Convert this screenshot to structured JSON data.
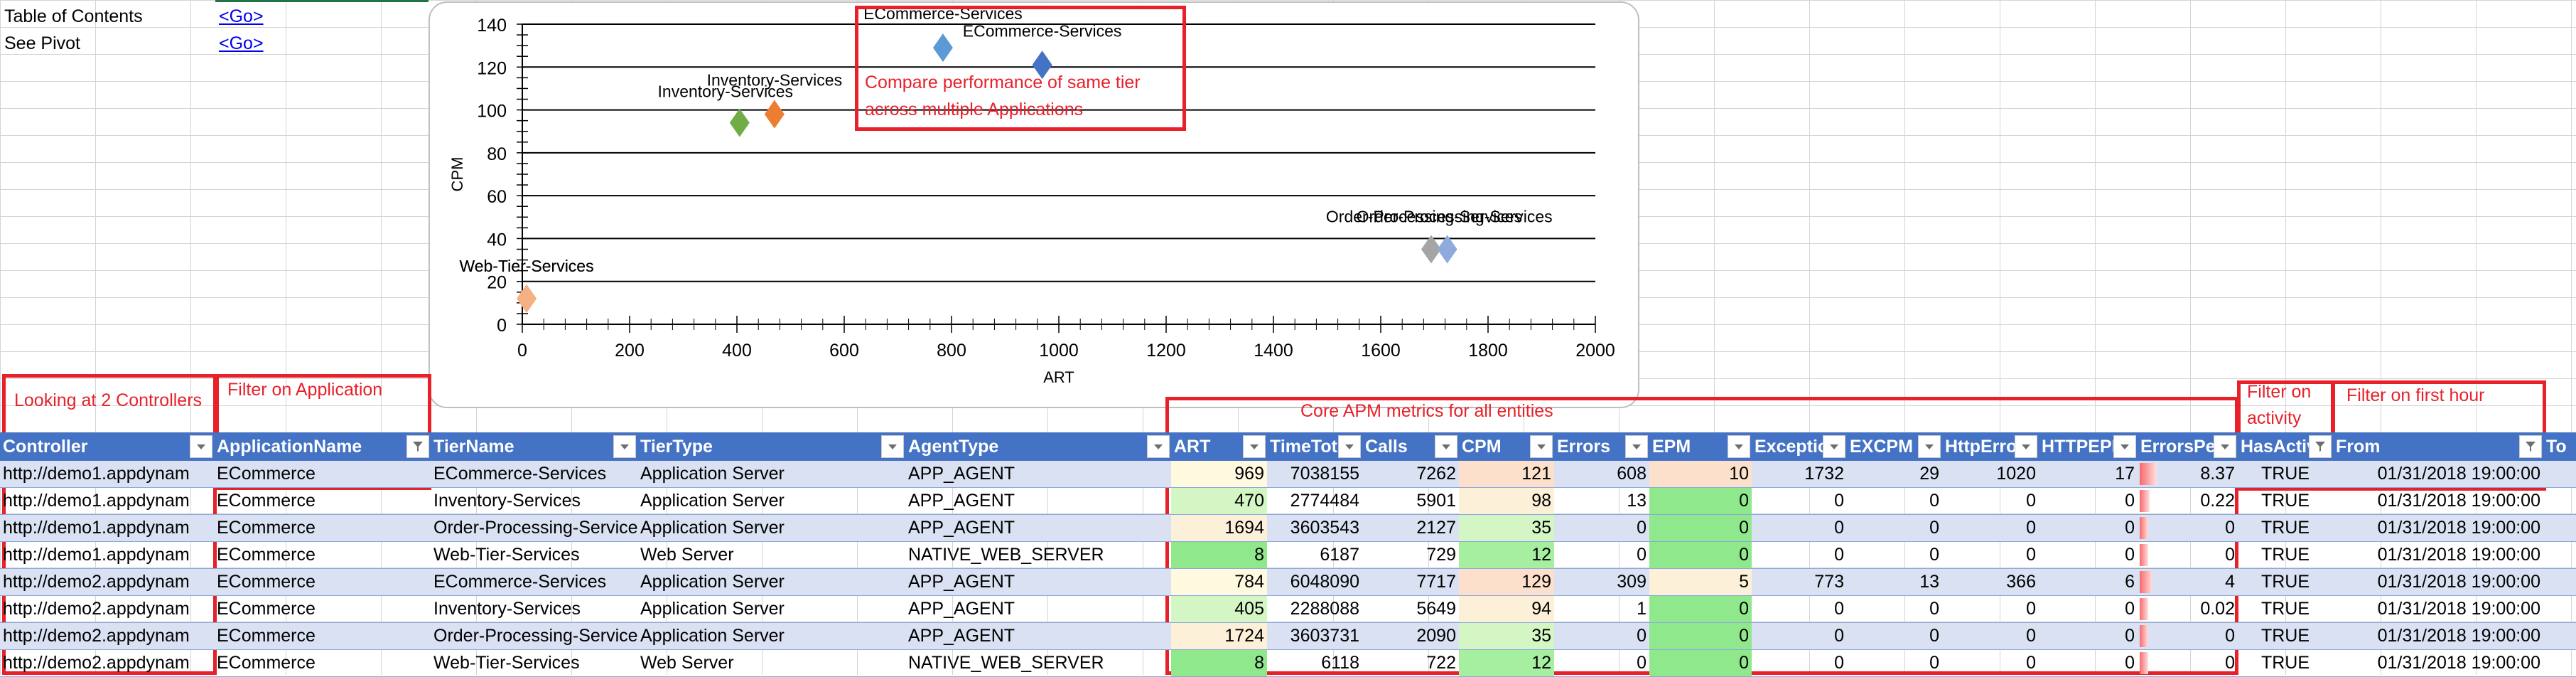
{
  "links": [
    {
      "label": "Table of Contents",
      "link_text": "<Go>"
    },
    {
      "label": "See Pivot",
      "link_text": "<Go>"
    }
  ],
  "annotations": {
    "chart_note": [
      "Compare performance of same tier",
      "across multiple Applications"
    ],
    "controllers": "Looking at 2 Controllers",
    "application": "Filter on Application",
    "core_metrics": "Core APM metrics for all entities",
    "activity": [
      "Filter on",
      "activity"
    ],
    "first_hour": "Filter on first hour"
  },
  "colors": {
    "header_blue": "#4472c4",
    "band_blue": "#d9e1f2",
    "annotation_red": "#e8202a",
    "scale_green": "#8fe98c",
    "scale_light_green": "#d4f6c4",
    "scale_yellow": "#fff9e0",
    "scale_peach": "#fde2c8",
    "scale_orange": "#fce4d6"
  },
  "chart_data": {
    "type": "scatter",
    "title": "",
    "xlabel": "ART",
    "ylabel": "CPM",
    "xlim": [
      0,
      2000
    ],
    "ylim": [
      0,
      140
    ],
    "x_ticks": [
      0,
      200,
      400,
      600,
      800,
      1000,
      1200,
      1400,
      1600,
      1800,
      2000
    ],
    "y_ticks": [
      0,
      20,
      40,
      60,
      80,
      100,
      120,
      140
    ],
    "grid": true,
    "legend": "none",
    "points": [
      {
        "label": "ECommerce-Services",
        "x": 969,
        "y": 121,
        "color": "#4472c4"
      },
      {
        "label": "Inventory-Services",
        "x": 470,
        "y": 98,
        "color": "#ed7d31"
      },
      {
        "label": "Order-Processing-Services",
        "x": 1694,
        "y": 35,
        "color": "#a5a5a5"
      },
      {
        "label": "Web-Tier-Services",
        "x": 8,
        "y": 12,
        "color": "#ffc000"
      },
      {
        "label": "ECommerce-Services",
        "x": 784,
        "y": 129,
        "color": "#5b9bd5"
      },
      {
        "label": "Inventory-Services",
        "x": 405,
        "y": 94,
        "color": "#70ad47"
      },
      {
        "label": "Order-Processing-Services",
        "x": 1724,
        "y": 35,
        "color": "#8faadc"
      },
      {
        "label": "Web-Tier-Services",
        "x": 8,
        "y": 12,
        "color": "#f4b183"
      }
    ]
  },
  "table": {
    "columns": [
      {
        "label": "Controller",
        "filter": "dropdown"
      },
      {
        "label": "ApplicationName",
        "filter": "active"
      },
      {
        "label": "TierName",
        "filter": "dropdown"
      },
      {
        "label": "TierType",
        "filter": "dropdown"
      },
      {
        "label": "AgentType",
        "filter": "dropdown"
      },
      {
        "label": "ART",
        "filter": "dropdown"
      },
      {
        "label": "TimeTot",
        "filter": "dropdown"
      },
      {
        "label": "Calls",
        "filter": "dropdown"
      },
      {
        "label": "CPM",
        "filter": "dropdown"
      },
      {
        "label": "Errors",
        "filter": "dropdown"
      },
      {
        "label": "EPM",
        "filter": "dropdown"
      },
      {
        "label": "Exceptio",
        "filter": "dropdown"
      },
      {
        "label": "EXCPM",
        "filter": "dropdown"
      },
      {
        "label": "HttpErro",
        "filter": "dropdown"
      },
      {
        "label": "HTTPEPM",
        "filter": "dropdown"
      },
      {
        "label": "ErrorsPe",
        "filter": "dropdown"
      },
      {
        "label": "HasActiv",
        "filter": "active"
      },
      {
        "label": "From",
        "filter": "active"
      },
      {
        "label": "To",
        "filter": "none"
      }
    ],
    "rows": [
      [
        "http://demo1.appdynam",
        "ECommerce",
        "ECommerce-Services",
        "Application Server",
        "APP_AGENT",
        "969",
        "7038155",
        "7262",
        "121",
        "608",
        "10",
        "1732",
        "29",
        "1020",
        "17",
        "8.37",
        "TRUE",
        "01/31/2018 19:00:00",
        ""
      ],
      [
        "http://demo1.appdynam",
        "ECommerce",
        "Inventory-Services",
        "Application Server",
        "APP_AGENT",
        "470",
        "2774484",
        "5901",
        "98",
        "13",
        "0",
        "0",
        "0",
        "0",
        "0",
        "0.22",
        "TRUE",
        "01/31/2018 19:00:00",
        ""
      ],
      [
        "http://demo1.appdynam",
        "ECommerce",
        "Order-Processing-Service",
        "Application Server",
        "APP_AGENT",
        "1694",
        "3603543",
        "2127",
        "35",
        "0",
        "0",
        "0",
        "0",
        "0",
        "0",
        "0",
        "TRUE",
        "01/31/2018 19:00:00",
        ""
      ],
      [
        "http://demo1.appdynam",
        "ECommerce",
        "Web-Tier-Services",
        "Web Server",
        "NATIVE_WEB_SERVER",
        "8",
        "6187",
        "729",
        "12",
        "0",
        "0",
        "0",
        "0",
        "0",
        "0",
        "0",
        "TRUE",
        "01/31/2018 19:00:00",
        ""
      ],
      [
        "http://demo2.appdynam",
        "ECommerce",
        "ECommerce-Services",
        "Application Server",
        "APP_AGENT",
        "784",
        "6048090",
        "7717",
        "129",
        "309",
        "5",
        "773",
        "13",
        "366",
        "6",
        "4",
        "TRUE",
        "01/31/2018 19:00:00",
        ""
      ],
      [
        "http://demo2.appdynam",
        "ECommerce",
        "Inventory-Services",
        "Application Server",
        "APP_AGENT",
        "405",
        "2288088",
        "5649",
        "94",
        "1",
        "0",
        "0",
        "0",
        "0",
        "0",
        "0.02",
        "TRUE",
        "01/31/2018 19:00:00",
        ""
      ],
      [
        "http://demo2.appdynam",
        "ECommerce",
        "Order-Processing-Service",
        "Application Server",
        "APP_AGENT",
        "1724",
        "3603731",
        "2090",
        "35",
        "0",
        "0",
        "0",
        "0",
        "0",
        "0",
        "0",
        "TRUE",
        "01/31/2018 19:00:00",
        ""
      ],
      [
        "http://demo2.appdynam",
        "ECommerce",
        "Web-Tier-Services",
        "Web Server",
        "NATIVE_WEB_SERVER",
        "8",
        "6118",
        "722",
        "12",
        "0",
        "0",
        "0",
        "0",
        "0",
        "0",
        "0",
        "TRUE",
        "01/31/2018 19:00:00",
        ""
      ]
    ],
    "cell_colors": {
      "ART": [
        "#fff9e0",
        "#d4f6c4",
        "#fdf0d8",
        "#8fe98c",
        "#fff9e0",
        "#d4f6c4",
        "#fdf0d8",
        "#8fe98c"
      ],
      "CPM": [
        "#fde0cc",
        "#fdf0d8",
        "#d4f6c4",
        "#a6eea0",
        "#fde0cc",
        "#fdf0d8",
        "#d4f6c4",
        "#a6eea0"
      ],
      "EPM": [
        "#fde0cc",
        "#8fe98c",
        "#8fe98c",
        "#8fe98c",
        "#fdf0d8",
        "#8fe98c",
        "#8fe98c",
        "#8fe98c"
      ]
    },
    "errors_perc_bar_fraction": [
      1.0,
      0.6,
      0.5,
      0.5,
      0.75,
      0.5,
      0.5,
      0.5
    ]
  }
}
